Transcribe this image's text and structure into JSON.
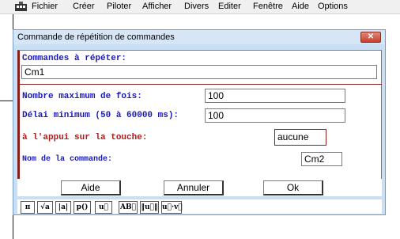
{
  "menu": [
    "Fichier",
    "Créer",
    "Piloter",
    "Afficher",
    "Divers",
    "Editer",
    "Fenêtre",
    "Aide",
    "Options"
  ],
  "side_button_label": "R",
  "dialog": {
    "title": "Commande de répétition de commandes",
    "close_label": "✕",
    "commands_label": "Commandes à répéter:",
    "commands_value": "Cm1",
    "max_times_label": "Nombre maximum de fois:",
    "max_times_value": "100",
    "delay_label": "Délai minimum (50 à 60000 ms):",
    "delay_value": "100",
    "key_label": "à l'appui sur la touche:",
    "key_value": "aucune",
    "name_label": "Nom de la commande:",
    "name_value": "Cm2",
    "buttons": {
      "help": "Aide",
      "cancel": "Annuler",
      "ok": "Ok"
    }
  },
  "toolbar": [
    "π",
    "√a",
    "|a|",
    "p()",
    "u⃗",
    "AB⃗",
    "‖u⃗‖",
    "u⃗·v⃗"
  ],
  "colors": {
    "dialog_bg": "#c9dff3",
    "label_blue": "#1a1ab5",
    "label_red": "#b01a1a",
    "close_red": "#c6402c"
  }
}
